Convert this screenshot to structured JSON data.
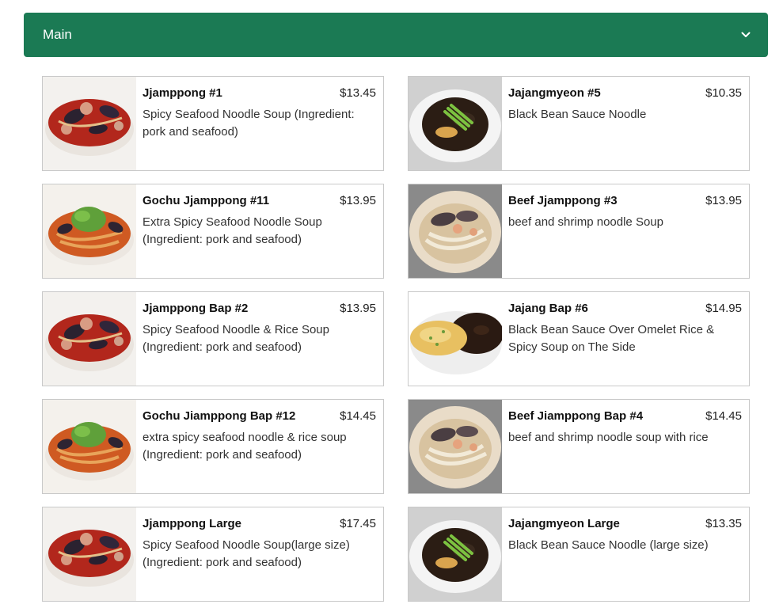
{
  "section": {
    "title": "Main",
    "chevron_icon": "chevron-down-icon",
    "header_color": "#1b7a54"
  },
  "items": [
    {
      "name": "Jjamppong #1",
      "price": "$13.45",
      "desc": "Spicy Seafood Noodle Soup (Ingredient: pork and seafood)",
      "image": "seafood-soup"
    },
    {
      "name": "Jajangmyeon #5",
      "price": "$10.35",
      "desc": "Black Bean Sauce Noodle",
      "image": "black-bean-noodle"
    },
    {
      "name": "Gochu Jjamppong #11",
      "price": "$13.95",
      "desc": "Extra Spicy Seafood Noodle Soup (Ingredient: pork and seafood)",
      "image": "spicy-soup-greens"
    },
    {
      "name": "Beef Jjamppong #3",
      "price": "$13.95",
      "desc": "beef and shrimp noodle Soup",
      "image": "beef-noodle-soup"
    },
    {
      "name": "Jjamppong Bap #2",
      "price": "$13.95",
      "desc": "Spicy Seafood Noodle & Rice Soup (Ingredient: pork and seafood)",
      "image": "seafood-soup"
    },
    {
      "name": "Jajang Bap #6",
      "price": "$14.95",
      "desc": "Black Bean Sauce Over Omelet Rice & Spicy Soup on The Side",
      "image": "omelet-rice"
    },
    {
      "name": "Gochu Jiamppong Bap #12",
      "price": "$14.45",
      "desc": "extra spicy seafood noodle & rice soup (Ingredient: pork and seafood)",
      "image": "spicy-soup-greens"
    },
    {
      "name": "Beef Jiamppong Bap #4",
      "price": "$14.45",
      "desc": "beef and shrimp noodle soup with rice",
      "image": "beef-noodle-soup"
    },
    {
      "name": "Jjamppong Large",
      "price": "$17.45",
      "desc": "Spicy Seafood Noodle Soup(large size) (Ingredient: pork and seafood)",
      "image": "seafood-soup"
    },
    {
      "name": "Jajangmyeon Large",
      "price": "$13.35",
      "desc": "Black Bean Sauce Noodle (large size)",
      "image": "black-bean-noodle"
    }
  ]
}
